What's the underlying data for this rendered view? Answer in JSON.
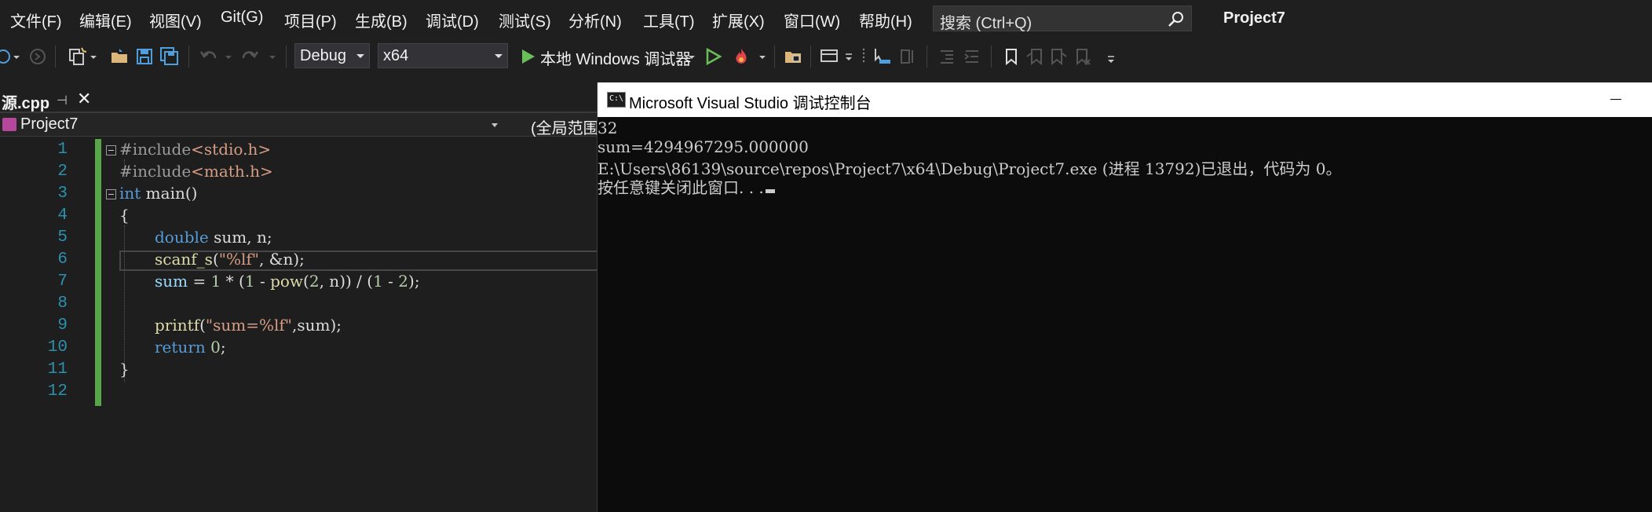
{
  "menu": {
    "items": [
      "文件(F)",
      "编辑(E)",
      "视图(V)",
      "Git(G)",
      "项目(P)",
      "生成(B)",
      "调试(D)",
      "测试(S)",
      "分析(N)",
      "工具(T)",
      "扩展(X)",
      "窗口(W)",
      "帮助(H)"
    ],
    "search_placeholder": "搜索 (Ctrl+Q)",
    "solution_title": "Project7"
  },
  "toolbar": {
    "configuration": "Debug",
    "platform": "x64",
    "run_label": "本地 Windows 调试器",
    "run_color": "#6bbf59"
  },
  "editor": {
    "tab_name": "源.cpp",
    "pin_glyph": "⊣",
    "close_glyph": "✕",
    "project": "Project7",
    "scope": "(全局范围)",
    "line_numbers": [
      "1",
      "2",
      "3",
      "4",
      "5",
      "6",
      "7",
      "8",
      "9",
      "10",
      "11",
      "12"
    ],
    "code": {
      "l1_pre": "#include",
      "l1_inc": "<stdio.h>",
      "l2_pre": "#include",
      "l2_inc": "<math.h>",
      "l3_kw": "int",
      "l3_rest": " main()",
      "l4": "{",
      "l5_kw": "double",
      "l5_rest": " sum, n;",
      "l6_fn": "scanf_s",
      "l6_open": "(",
      "l6_str": "\"%lf\"",
      "l6_rest": ", &n);",
      "l7_var": "sum",
      "l7_a": " = ",
      "l7_n1": "1",
      "l7_b": " * (",
      "l7_n2": "1",
      "l7_c": " - ",
      "l7_fn": "pow",
      "l7_d": "(",
      "l7_n3": "2",
      "l7_e": ", n)) / (",
      "l7_n4": "1",
      "l7_f": " - ",
      "l7_n5": "2",
      "l7_g": ");",
      "l9_fn": "printf",
      "l9_open": "(",
      "l9_str": "\"sum=%lf\"",
      "l9_rest": ",sum);",
      "l10_kw": "return",
      "l10_sp": " ",
      "l10_num": "0",
      "l10_end": ";",
      "l11": "}"
    }
  },
  "console": {
    "icon_text": "C:\\",
    "title": "Microsoft Visual Studio 调试控制台",
    "lines": [
      "32",
      "sum=4294967295.000000",
      "E:\\Users\\86139\\source\\repos\\Project7\\x64\\Debug\\Project7.exe (进程 13792)已退出，代码为 0。",
      "按任意键关闭此窗口. . ."
    ]
  }
}
